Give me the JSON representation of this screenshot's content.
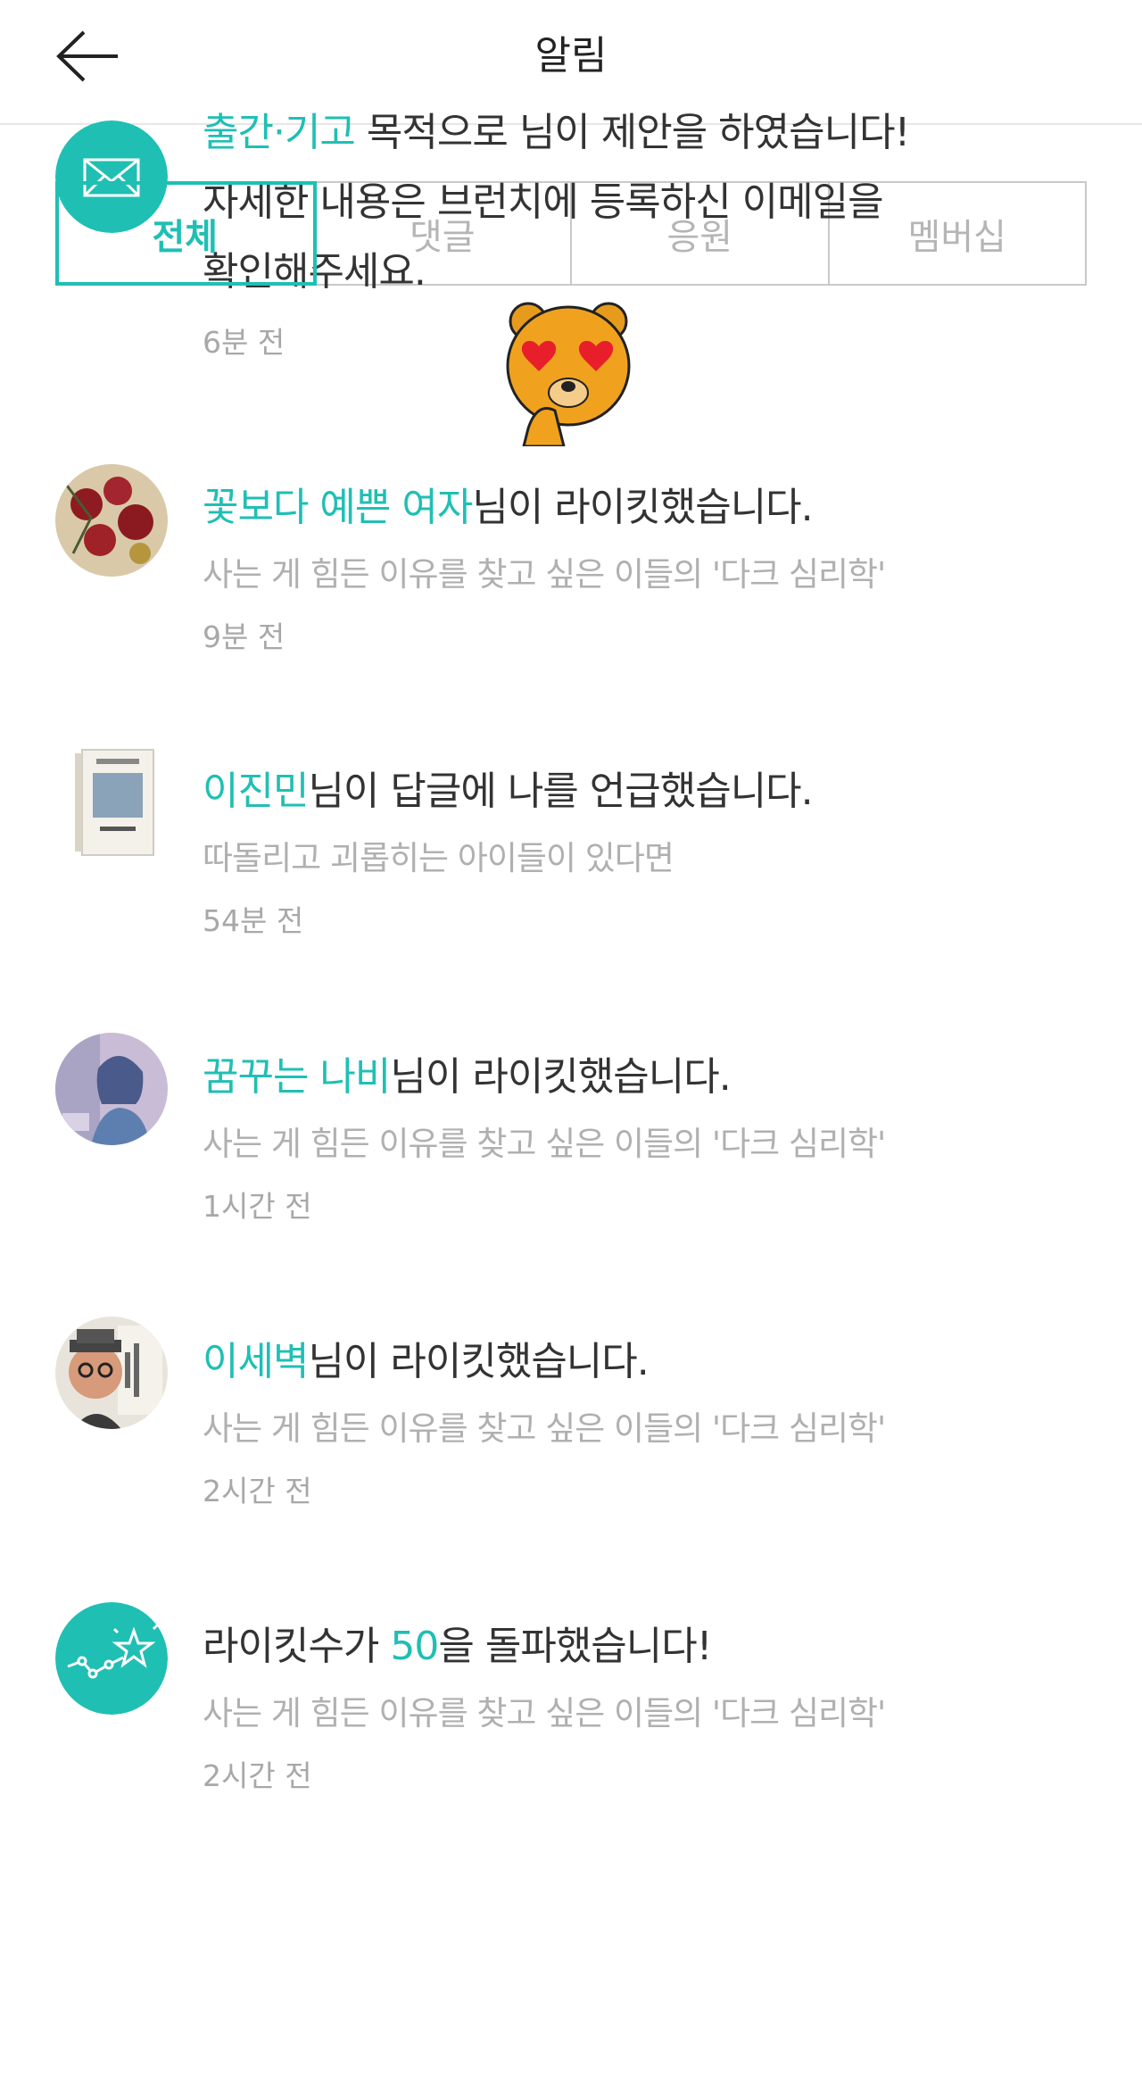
{
  "header": {
    "title": "알림",
    "back_icon": "arrow-left-icon"
  },
  "tabs": [
    {
      "label": "전체",
      "active": true
    },
    {
      "label": "댓글",
      "active": false
    },
    {
      "label": "응원",
      "active": false
    },
    {
      "label": "멤버십",
      "active": false
    }
  ],
  "colors": {
    "accent": "#1fbfb4",
    "text": "#333333",
    "muted": "#b0b0b0"
  },
  "notifications": [
    {
      "icon": "mail-icon",
      "highlight": "출간·기고",
      "line1_rest": " 목적으로 ",
      "line1_tail": "님이 제안을 하였습니다!",
      "line2": "자세한 내용은 브런치에 등록하신 이메일을",
      "line3": "확인해주세요.",
      "time": "6분 전"
    },
    {
      "icon": "roses-avatar",
      "highlight": "꽃보다 예쁜 여자",
      "rest": "님이 라이킷했습니다.",
      "sub": "사는 게 힘든 이유를 찾고 싶은 이들의 '다크 심리학'",
      "time": "9분 전"
    },
    {
      "icon": "book-cover-avatar",
      "highlight": "이진민",
      "rest": "님이 답글에 나를 언급했습니다.",
      "sub": "따돌리고 괴롭히는 아이들이 있다면",
      "time": "54분 전"
    },
    {
      "icon": "illustration-avatar",
      "highlight": "꿈꾸는 나비",
      "rest": "님이 라이킷했습니다.",
      "sub": "사는 게 힘든 이유를 찾고 싶은 이들의 '다크 심리학'",
      "time": "1시간 전"
    },
    {
      "icon": "portrait-avatar",
      "highlight": "이세벽",
      "rest": "님이 라이킷했습니다.",
      "sub": "사는 게 힘든 이유를 찾고 싶은 이들의 '다크 심리학'",
      "time": "2시간 전"
    },
    {
      "icon": "milestone-star-icon",
      "prefix": "라이킷수가 ",
      "highlight": "50",
      "rest": "을 돌파했습니다!",
      "sub": "사는 게 힘든 이유를 찾고 싶은 이들의 '다크 심리학'",
      "time": "2시간 전"
    }
  ]
}
